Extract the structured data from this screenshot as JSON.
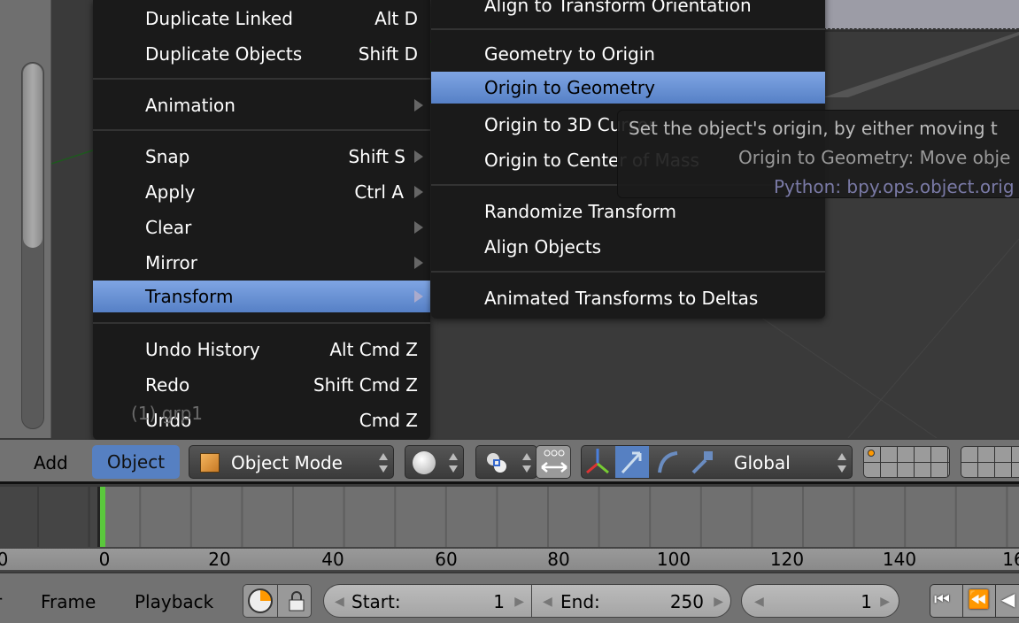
{
  "object_menu": {
    "items": [
      {
        "label": "Duplicate Linked",
        "shortcut": "Alt D"
      },
      {
        "label": "Duplicate Objects",
        "shortcut": "Shift D"
      },
      {
        "label": "Animation",
        "submenu": true
      },
      {
        "label": "Snap",
        "shortcut": "Shift S",
        "submenu": true
      },
      {
        "label": "Apply",
        "shortcut": "Ctrl A",
        "submenu": true
      },
      {
        "label": "Clear",
        "submenu": true
      },
      {
        "label": "Mirror",
        "submenu": true
      },
      {
        "label": "Transform",
        "submenu": true,
        "highlighted": true
      },
      {
        "label": "Undo History",
        "shortcut": "Alt Cmd Z"
      },
      {
        "label": "Redo",
        "shortcut": "Shift Cmd Z"
      },
      {
        "label": "Undo",
        "shortcut": "Cmd Z"
      }
    ]
  },
  "transform_menu": {
    "items": [
      {
        "label": "Align to Transform Orientation"
      },
      {
        "label": "Geometry to Origin"
      },
      {
        "label": "Origin to Geometry",
        "highlighted": true
      },
      {
        "label": "Origin to 3D Cursor"
      },
      {
        "label": "Origin to Center of Mass"
      },
      {
        "label": "Randomize Transform"
      },
      {
        "label": "Align Objects"
      },
      {
        "label": "Animated Transforms to Deltas"
      }
    ]
  },
  "tooltip": {
    "line1": "Set the object's origin, by either moving t",
    "line2": "Origin to Geometry: Move obje",
    "line3": "Python: bpy.ops.object.orig"
  },
  "viewport": {
    "object_label": "(1) grp1"
  },
  "header": {
    "add": "Add",
    "object": "Object",
    "mode": "Object Mode",
    "orientation": "Global"
  },
  "timeline": {
    "ticks": [
      "0",
      "0",
      "20",
      "40",
      "60",
      "80",
      "100",
      "120",
      "140",
      "16"
    ],
    "current_frame": 0
  },
  "bottom": {
    "partial": "r",
    "frame": "Frame",
    "playback": "Playback",
    "start_label": "Start:",
    "start_value": "1",
    "end_label": "End:",
    "end_value": "250",
    "current": "1"
  },
  "colors": {
    "highlight": "#5680c6",
    "menu_bg": "#1a1a1a",
    "playhead": "#5ac83c",
    "tooltip_python": "#7a7aa6"
  }
}
